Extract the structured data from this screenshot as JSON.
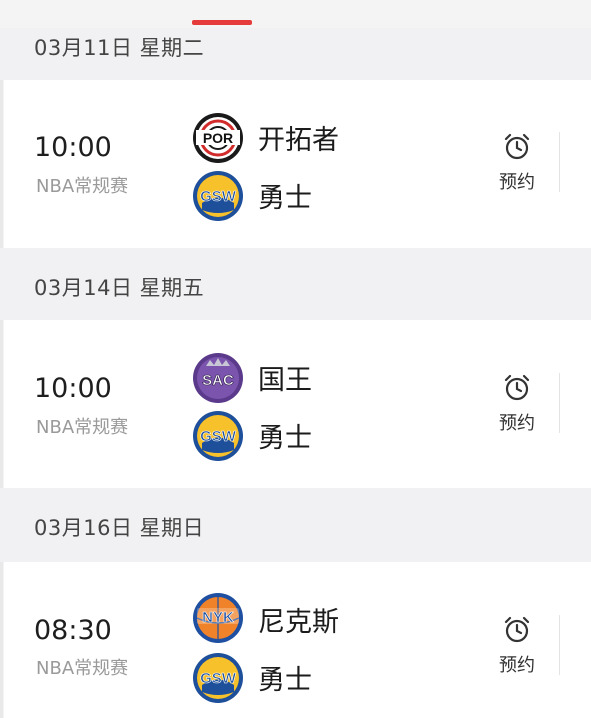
{
  "tab_indicator_color": "#e53b3b",
  "sections": [
    {
      "date": "03月11日 星期二",
      "match": {
        "time": "10:00",
        "league": "NBA常规赛",
        "home": {
          "name": "开拓者",
          "logo_text": "POR",
          "icon": "trail-blazers-logo-icon"
        },
        "away": {
          "name": "勇士",
          "logo_text": "GSW",
          "icon": "warriors-logo-icon"
        },
        "reminder_label": "预约",
        "reminder_icon": "alarm-clock-icon"
      }
    },
    {
      "date": "03月14日 星期五",
      "match": {
        "time": "10:00",
        "league": "NBA常规赛",
        "home": {
          "name": "国王",
          "logo_text": "SAC",
          "icon": "kings-logo-icon"
        },
        "away": {
          "name": "勇士",
          "logo_text": "GSW",
          "icon": "warriors-logo-icon"
        },
        "reminder_label": "预约",
        "reminder_icon": "alarm-clock-icon"
      }
    },
    {
      "date": "03月16日 星期日",
      "match": {
        "time": "08:30",
        "league": "NBA常规赛",
        "home": {
          "name": "尼克斯",
          "logo_text": "NYK",
          "icon": "knicks-logo-icon"
        },
        "away": {
          "name": "勇士",
          "logo_text": "GSW",
          "icon": "warriors-logo-icon"
        },
        "reminder_label": "预约",
        "reminder_icon": "alarm-clock-icon"
      }
    }
  ]
}
